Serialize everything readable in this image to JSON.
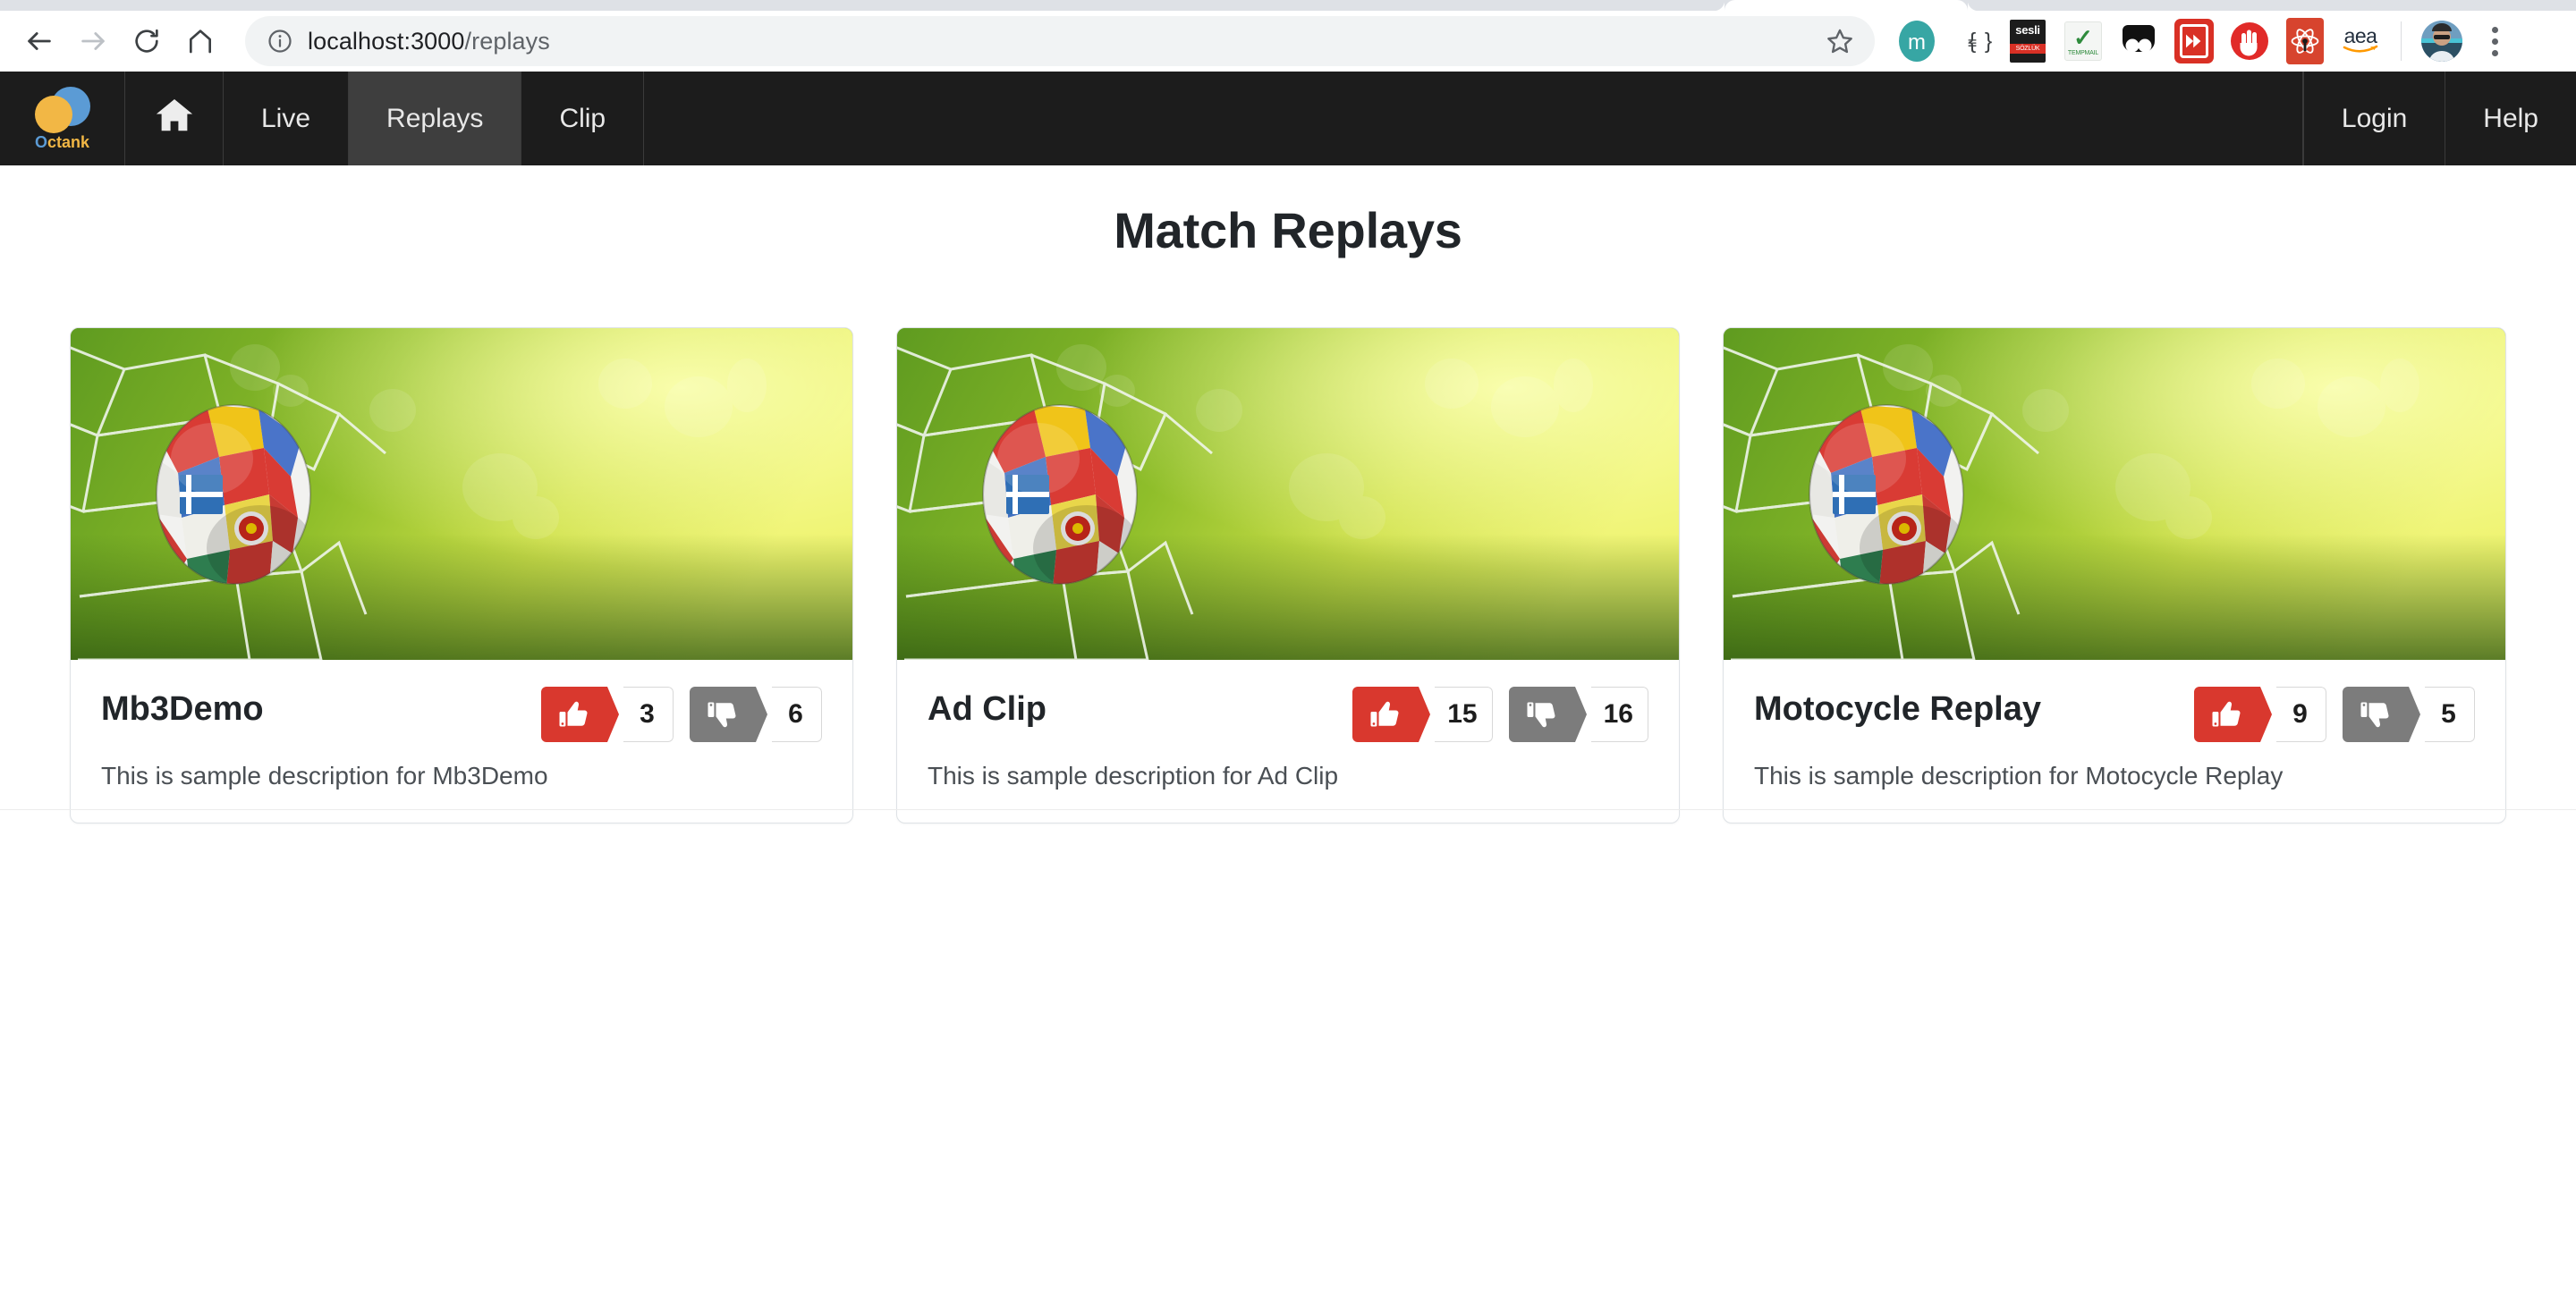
{
  "browser": {
    "back_icon": "back-arrow-icon",
    "forward_icon": "forward-arrow-icon",
    "reload_icon": "reload-icon",
    "home_icon": "home-icon",
    "site_info_icon": "info-circle-icon",
    "url_host": "localhost:3000",
    "url_path": "/replays",
    "url_full": "localhost:3000/replays",
    "bookmark_icon": "star-icon",
    "menu_icon": "kebab-menu-icon",
    "extensions": [
      {
        "name": "monica-extension",
        "label": "m"
      },
      {
        "name": "json-formatter-extension",
        "label": "{≡}"
      },
      {
        "name": "sesli-sozluk-extension",
        "top": "sesli",
        "bottom": "SÖZLÜK"
      },
      {
        "name": "tempmail-extension",
        "label": "TEMPMAIL"
      },
      {
        "name": "dark-reader-extension",
        "label": ""
      },
      {
        "name": "video-speed-extension",
        "label": "»"
      },
      {
        "name": "adblock-extension",
        "label": "✋"
      },
      {
        "name": "react-devtools-extension",
        "label": ""
      },
      {
        "name": "amazon-assistant-extension",
        "label": "aea"
      }
    ],
    "avatar_name": "profile-avatar"
  },
  "appnav": {
    "brand": {
      "name": "octank-logo",
      "text_first": "O",
      "text_rest": "ctank",
      "full": "Octank"
    },
    "home_icon": "home-icon",
    "left_items": [
      {
        "label": "Live",
        "name": "nav-item-live",
        "active": false
      },
      {
        "label": "Replays",
        "name": "nav-item-replays",
        "active": true
      },
      {
        "label": "Clip",
        "name": "nav-item-clip",
        "active": false
      }
    ],
    "right_items": [
      {
        "label": "Login",
        "name": "nav-item-login"
      },
      {
        "label": "Help",
        "name": "nav-item-help"
      }
    ],
    "colors": {
      "bar": "#1c1c1c",
      "active": "#3e3e3e",
      "text": "#e8e8e8"
    }
  },
  "main": {
    "title": "Match Replays",
    "cards": [
      {
        "title": "Mb3Demo",
        "description": "This is sample description for Mb3Demo",
        "likes": "3",
        "dislikes": "6",
        "thumbnail_alt": "soccer-ball-in-goal-net"
      },
      {
        "title": "Ad Clip",
        "description": "This is sample description for Ad Clip",
        "likes": "15",
        "dislikes": "16",
        "thumbnail_alt": "soccer-ball-in-goal-net"
      },
      {
        "title": "Motocycle Replay",
        "description": "This is sample description for Motocycle Replay",
        "likes": "9",
        "dislikes": "5",
        "thumbnail_alt": "soccer-ball-in-goal-net"
      }
    ],
    "colors": {
      "like": "#d9382e",
      "dislike": "#7c7c7c",
      "card_border": "#dee2e6",
      "title_text": "#212529",
      "body_text": "#4a4f54"
    }
  }
}
